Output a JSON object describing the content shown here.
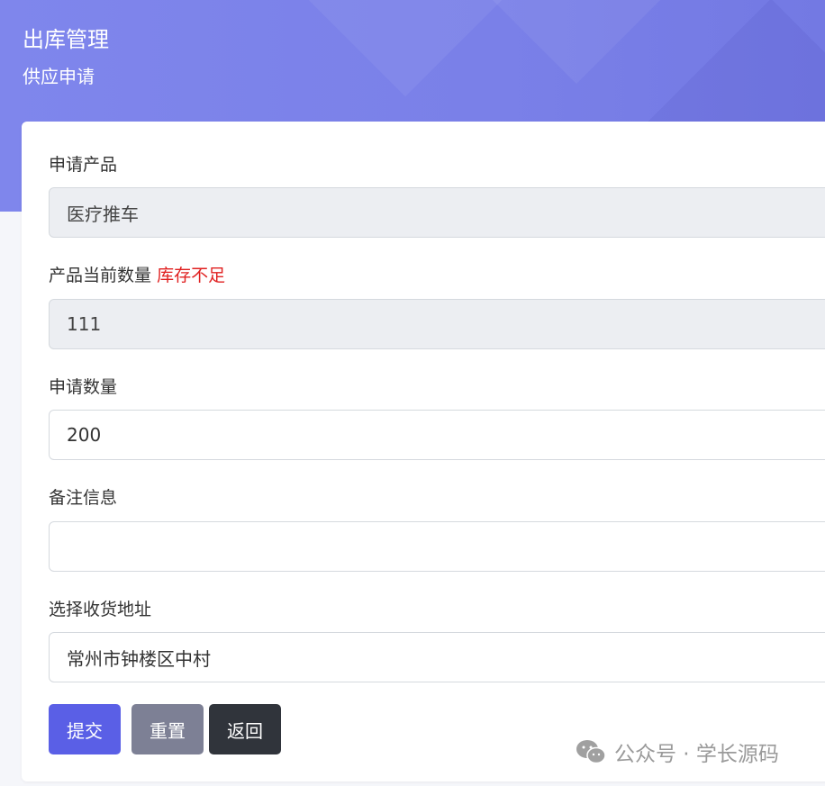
{
  "header": {
    "title": "出库管理",
    "subtitle": "供应申请"
  },
  "form": {
    "product": {
      "label": "申请产品",
      "value": "医疗推车"
    },
    "stock": {
      "label": "产品当前数量",
      "warning": "库存不足",
      "value": "111"
    },
    "quantity": {
      "label": "申请数量",
      "value": "200"
    },
    "remark": {
      "label": "备注信息",
      "value": ""
    },
    "address": {
      "label": "选择收货地址",
      "value": "常州市钟楼区中村"
    }
  },
  "buttons": {
    "submit": "提交",
    "reset": "重置",
    "back": "返回"
  },
  "watermark": {
    "text": "公众号 · 学长源码",
    "icon": "wechat-icon"
  },
  "colors": {
    "header": "#7a80e8",
    "submit": "#5a5fe6",
    "reset": "#7d8095",
    "back": "#30343b",
    "warning": "#e02020"
  }
}
